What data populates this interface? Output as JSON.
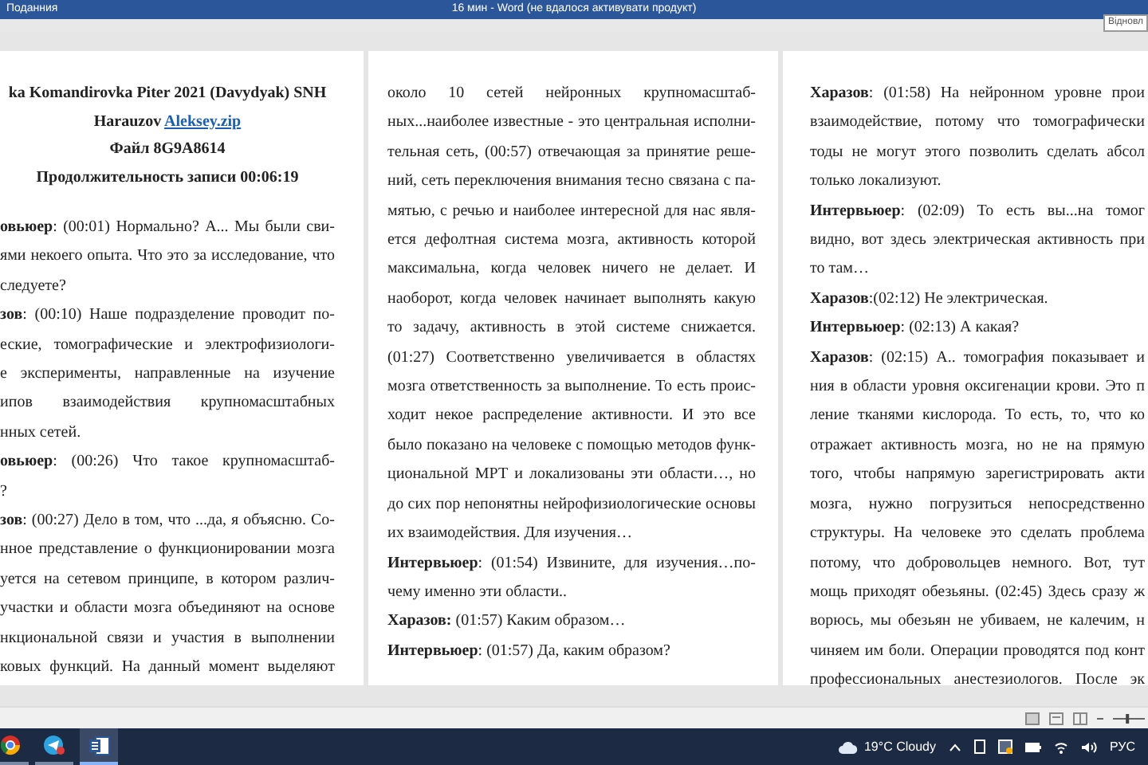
{
  "title_bar": {
    "left_text": "Поданния",
    "title": "16 мин - Word (не вдалося активувати продукт)",
    "tooltip": "Відновл"
  },
  "pages": [
    {
      "lines": [
        {
          "kind": "center",
          "text": "ka Komandirovka Piter 2021 (Davydyak) SNH"
        },
        {
          "kind": "link",
          "text": "Harauzov",
          "link": "Aleksey.zip"
        },
        {
          "kind": "center",
          "text": "Файл 8G9A8614"
        },
        {
          "kind": "center",
          "text": "Продолжительность записи 00:06:19"
        },
        {
          "kind": "full",
          "text": "**овьюер**: (00:01) Нормально? А... Мы были сви-"
        },
        {
          "kind": "full",
          "text": "ями некоего опыта. Что это за исследование, что"
        },
        {
          "kind": "end",
          "text": "следуете?"
        },
        {
          "kind": "full",
          "text": "**зов**: (00:10) Наше подразделение проводит по-"
        },
        {
          "kind": "full",
          "text": "еские, томографические и электрофизиологи-"
        },
        {
          "kind": "full",
          "text": "е эксперименты, направленные на изучение"
        },
        {
          "kind": "full",
          "text": "ипов взаимодействия крупномасштабных"
        },
        {
          "kind": "end",
          "text": "нных сетей."
        },
        {
          "kind": "full",
          "text": "**овьюер**: (00:26) Что такое крупномасштаб-"
        },
        {
          "kind": "end",
          "text": "?"
        },
        {
          "kind": "full",
          "text": "**зов**: (00:27) Дело в том, что ...да, я объясню. Со-"
        },
        {
          "kind": "full",
          "text": "нное представление о функционировании мозга"
        },
        {
          "kind": "full",
          "text": "уется на сетевом принципе, в котором различ-"
        },
        {
          "kind": "full",
          "text": "участки и области мозга объединяют на основе"
        },
        {
          "kind": "full",
          "text": "нкциональной связи и участия в выполнении"
        },
        {
          "kind": "full",
          "text": "ковых функций. На данный момент выделяют"
        }
      ]
    },
    {
      "lines": [
        {
          "kind": "full",
          "text": "около 10 сетей нейронных крупномасштаб-"
        },
        {
          "kind": "full",
          "text": "ных...наиболее известные - это центральная исполни-"
        },
        {
          "kind": "full",
          "text": "тельная сеть, (00:57) отвечающая за принятие реше-"
        },
        {
          "kind": "full",
          "text": "ний, сеть переключения внимания тесно связана с па-"
        },
        {
          "kind": "full",
          "text": "мятью, с речью и наиболее интересной для нас явля-"
        },
        {
          "kind": "full",
          "text": "ется дефолтная система мозга, активность которой"
        },
        {
          "kind": "full",
          "text": "максимальна, когда человек ничего не делает. И"
        },
        {
          "kind": "full",
          "text": "наоборот, когда человек начинает выполнять какую"
        },
        {
          "kind": "full",
          "text": "то задачу, активность в этой системе снижается."
        },
        {
          "kind": "full",
          "text": "(01:27) Соответственно увеличивается в областях"
        },
        {
          "kind": "full",
          "text": "мозга ответственность за выполнение. То есть проис-"
        },
        {
          "kind": "full",
          "text": "ходит некое распределение активности. И это все"
        },
        {
          "kind": "full",
          "text": "было показано на человеке с помощью методов функ-"
        },
        {
          "kind": "full",
          "text": "циональной МРТ и локализованы эти области…, но"
        },
        {
          "kind": "full",
          "text": "до сих пор непонятны нейрофизиологические основы"
        },
        {
          "kind": "end",
          "text": "их взаимодействия. Для изучения…"
        },
        {
          "kind": "full",
          "text": "**Интервьюер**: (01:54) Извините, для изучения…по-"
        },
        {
          "kind": "end",
          "text": "чему именно эти области.."
        },
        {
          "kind": "end",
          "text": "**Харазов:** (01:57) Каким образом…"
        },
        {
          "kind": "end",
          "text": "**Интервьюер**: (01:57) Да, каким образом?"
        }
      ]
    },
    {
      "lines": [
        {
          "kind": "full",
          "text": "**Харазов**: (01:58) На нейронном уровне прои"
        },
        {
          "kind": "full",
          "text": "взаимодействие, потому что томографически"
        },
        {
          "kind": "full",
          "text": "тоды не могут этого позволить сделать абсол"
        },
        {
          "kind": "end",
          "text": "только локализуют."
        },
        {
          "kind": "full",
          "text": "**Интервьюер**: (02:09) То есть вы...на томог"
        },
        {
          "kind": "full",
          "text": "видно, вот здесь электрическая активность при"
        },
        {
          "kind": "end",
          "text": "то там…"
        },
        {
          "kind": "end",
          "text": "**Харазов**:(02:12) Не электрическая."
        },
        {
          "kind": "end",
          "text": "**Интервьюер**: (02:13) А какая?"
        },
        {
          "kind": "full",
          "text": "**Харазов**: (02:15) А.. томография показывает и"
        },
        {
          "kind": "full",
          "text": "ния в области уровня оксигенации крови. Это п"
        },
        {
          "kind": "full",
          "text": "ление тканями кислорода. То есть, то, что ко"
        },
        {
          "kind": "full",
          "text": "отражает активность мозга, но не на прямую"
        },
        {
          "kind": "full",
          "text": "того, чтобы напрямую зарегистрировать акти"
        },
        {
          "kind": "full",
          "text": "мозга, нужно погрузиться непосредственно"
        },
        {
          "kind": "full",
          "text": "структуры. На человеке это сделать проблема"
        },
        {
          "kind": "full",
          "text": "потому, что добровольцев немного. Вот, тут"
        },
        {
          "kind": "full",
          "text": "мощь приходят обезьяны. (02:45) Здесь сразу ж"
        },
        {
          "kind": "full",
          "text": "ворюсь, мы обезьян не убиваем, не калечим, н"
        },
        {
          "kind": "full",
          "text": "чиняем им боли. Операции проводятся под конт"
        },
        {
          "kind": "full",
          "text": "профессиональных анестезиологов. После эк"
        }
      ]
    }
  ],
  "status_bar": {
    "zoom": {
      "level": 0.45
    }
  },
  "taskbar": {
    "apps": [
      {
        "kind": "browser",
        "selected": false
      },
      {
        "kind": "messenger",
        "selected": false
      },
      {
        "kind": "word",
        "selected": true
      }
    ],
    "weather": "19°C Cloudy",
    "language": "РУС"
  }
}
